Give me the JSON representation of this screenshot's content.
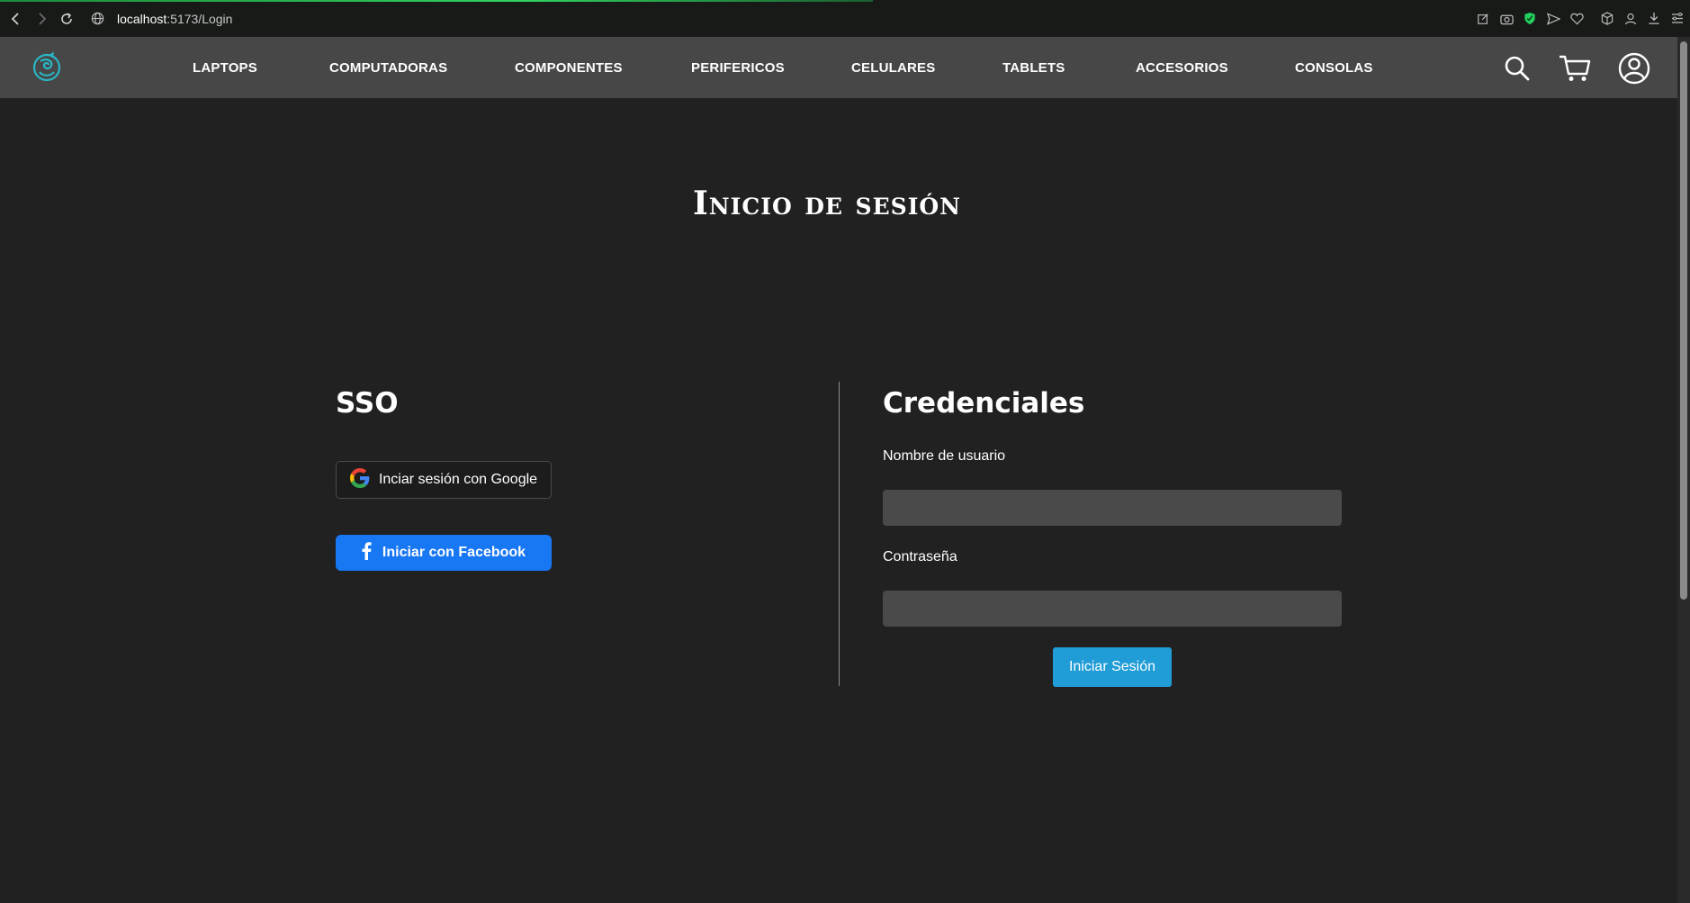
{
  "browser": {
    "url_host": "localhost",
    "url_path": ":5173/Login"
  },
  "nav": {
    "items": [
      {
        "label": "LAPTOPS"
      },
      {
        "label": "COMPUTADORAS"
      },
      {
        "label": "COMPONENTES"
      },
      {
        "label": "PERIFERICOS"
      },
      {
        "label": "CELULARES"
      },
      {
        "label": "TABLETS"
      },
      {
        "label": "ACCESORIOS"
      },
      {
        "label": "CONSOLAS"
      }
    ],
    "icons": [
      "search-icon",
      "cart-icon",
      "user-icon"
    ]
  },
  "page": {
    "title": "Inicio de sesión"
  },
  "sso": {
    "heading": "SSO",
    "google_label": "Inciar sesión con Google",
    "facebook_label": "Iniciar con Facebook"
  },
  "credentials": {
    "heading": "Credenciales",
    "username_label": "Nombre de usuario",
    "username_value": "",
    "password_label": "Contraseña",
    "password_value": "",
    "submit_label": "Iniciar Sesión"
  },
  "colors": {
    "page_bg": "#212121",
    "navbar_bg": "#474747",
    "input_bg": "#4a4a4a",
    "facebook_blue": "#1877f2",
    "submit_blue": "#209cd6",
    "logo_teal": "#29b6c5"
  }
}
